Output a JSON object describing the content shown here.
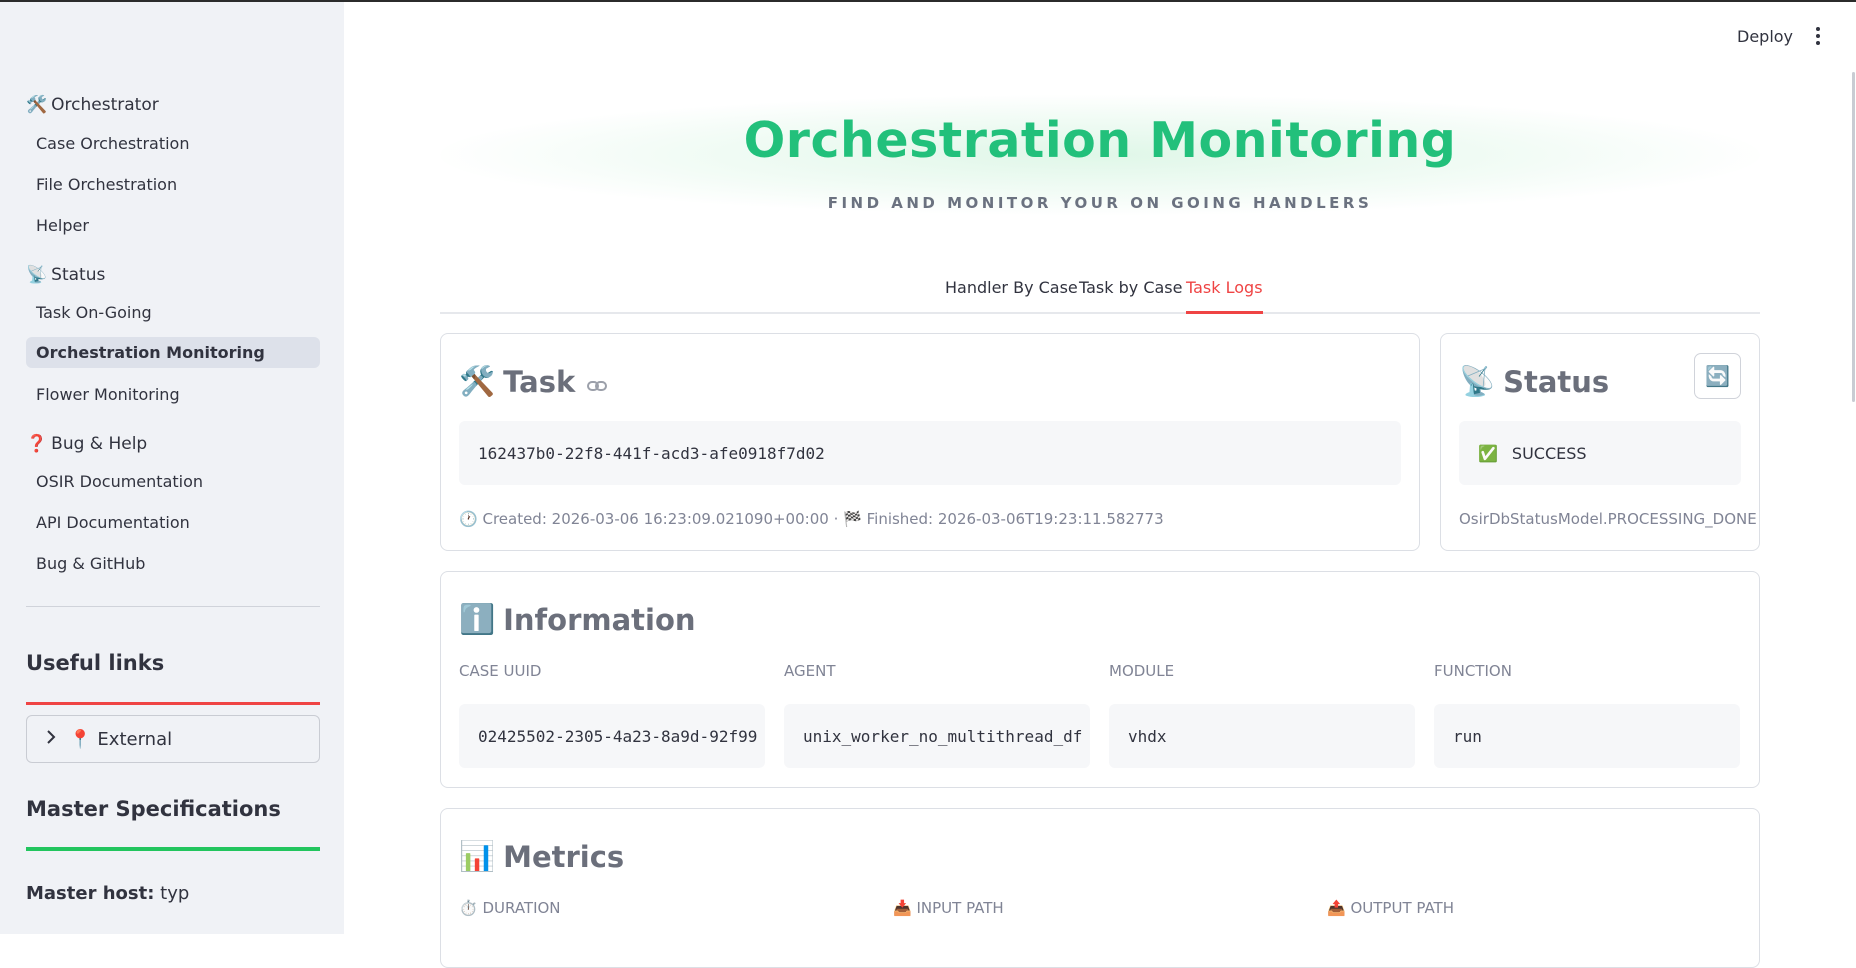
{
  "sidebar": {
    "sections": [
      {
        "icon": "🛠️",
        "label": "Orchestrator",
        "items": [
          "Case Orchestration",
          "File Orchestration",
          "Helper"
        ]
      },
      {
        "icon": "📡",
        "label": "Status",
        "items": [
          "Task On-Going",
          "Orchestration Monitoring",
          "Flower Monitoring"
        ]
      },
      {
        "icon": "❓",
        "label": "Bug & Help",
        "items": [
          "OSIR Documentation",
          "API Documentation",
          "Bug & GitHub"
        ]
      }
    ],
    "active_item": "Orchestration Monitoring",
    "useful_links": "Useful links",
    "external": {
      "icon": "📍",
      "label": "External"
    },
    "master_specs": "Master Specifications",
    "master_host_label": "Master host:",
    "master_host_value": "typ"
  },
  "header": {
    "deploy_label": "Deploy"
  },
  "hero": {
    "title": "Orchestration Monitoring",
    "subtitle": "FIND AND MONITOR YOUR ON GOING HANDLERS"
  },
  "tabs": [
    {
      "label": "Handler By Case",
      "active": false
    },
    {
      "label": "Task by Case",
      "active": false
    },
    {
      "label": "Task Logs",
      "active": true
    }
  ],
  "task_card": {
    "icon": "🛠️",
    "title": "Task",
    "task_id": "162437b0-22f8-441f-acd3-afe0918f7d02",
    "created_icon": "🕐",
    "created": "Created: 2026-03-06 16:23:09.021090+00:00",
    "separator": "·",
    "finished_icon": "🏁",
    "finished": "Finished: 2026-03-06T19:23:11.582773"
  },
  "status_card": {
    "icon": "📡",
    "title": "Status",
    "refresh_icon": "🔄",
    "status_icon": "✅",
    "status": "SUCCESS",
    "db_status": "OsirDbStatusModel.PROCESSING_DONE"
  },
  "info_card": {
    "icon": "ℹ️",
    "title": "Information",
    "fields": [
      {
        "label": "CASE UUID",
        "value": "02425502-2305-4a23-8a9d-92f99"
      },
      {
        "label": "AGENT",
        "value": "unix_worker_no_multithread_df"
      },
      {
        "label": "MODULE",
        "value": "vhdx"
      },
      {
        "label": "FUNCTION",
        "value": "run"
      }
    ]
  },
  "metrics_card": {
    "icon": "📊",
    "title": "Metrics",
    "fields": [
      {
        "icon": "⏱️",
        "label": "DURATION"
      },
      {
        "icon": "📥",
        "label": "INPUT PATH"
      },
      {
        "icon": "📤",
        "label": "OUTPUT PATH"
      }
    ]
  },
  "colors": {
    "accent_red": "#ef4444",
    "accent_green": "#22c07b",
    "sidebar_bg": "#f0f2f6"
  }
}
